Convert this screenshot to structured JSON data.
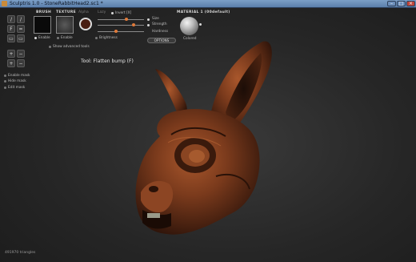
{
  "window": {
    "title": "Sculptris 1.0 - StoneRabbitHead2.sc1 *"
  },
  "left_toolbar": [
    "/",
    "/",
    "F",
    "=",
    "▭",
    "▭",
    "+",
    "−",
    "+",
    "−"
  ],
  "panels": {
    "brush_label": "BRUSH",
    "texture_label": "TEXTURE",
    "alpha_label": "Alpha",
    "enable_brush": "Enable",
    "enable_texture": "Enable",
    "show_advanced": "Show advanced tools"
  },
  "sliders": {
    "invert_label": "Invert [X]",
    "size_label": "Size",
    "strength_label": "Strength",
    "hardness_label": "Hardness",
    "brightness_label": "Brightness",
    "size_value": 0.62,
    "strength_value": 0.78,
    "hardness_value": 0.4
  },
  "material": {
    "header": "MATERIAL 1 (00default)",
    "colored_label": "Colored",
    "options_label": "OPTIONS"
  },
  "masks": [
    "Enable mask",
    "Hide mask",
    "Edit mask"
  ],
  "tool": "Tool: Flatten bump (F)",
  "status": {
    "triangles": "491970 triangles"
  },
  "colors": {
    "accent": "#e07a3a",
    "titlebar": "#6a8dba",
    "viewport": "#262626",
    "model": "#7a3a1c"
  }
}
